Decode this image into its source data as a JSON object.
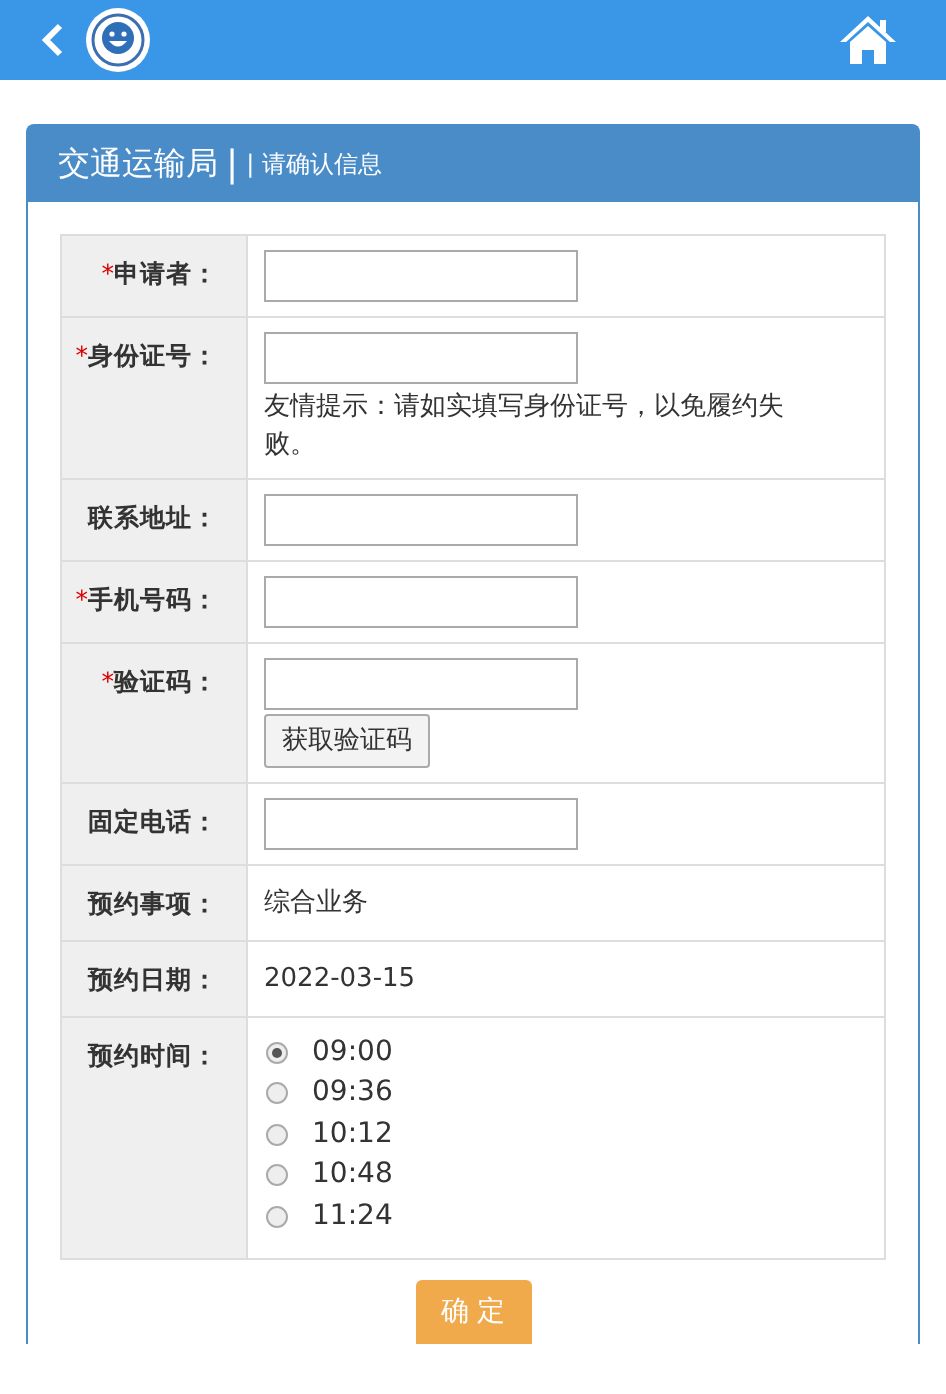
{
  "panel": {
    "title": "交通运输局",
    "separator": "|",
    "subtitle": "| 请确认信息"
  },
  "rows": [
    {
      "kind": "input",
      "required_mark": "*",
      "label": "申请者："
    },
    {
      "kind": "input_hint",
      "required_mark": "*",
      "label": "身份证号：",
      "hint": "友情提示：请如实填写身份证号，以免履约失败。"
    },
    {
      "kind": "input",
      "label": "联系地址："
    },
    {
      "kind": "input",
      "required_mark": "*",
      "label": "手机号码："
    },
    {
      "kind": "input_button",
      "required_mark": "*",
      "label": "验证码：",
      "button": "获取验证码"
    },
    {
      "kind": "input",
      "label": "固定电话："
    },
    {
      "kind": "text",
      "label": "预约事项：",
      "value": "综合业务"
    },
    {
      "kind": "text",
      "label": "预约日期：",
      "value": "2022-03-15"
    },
    {
      "kind": "radio",
      "label": "预约时间：",
      "options": [
        {
          "label": "09:00",
          "selected": true
        },
        {
          "label": "09:36",
          "selected": false
        },
        {
          "label": "10:12",
          "selected": false
        },
        {
          "label": "10:48",
          "selected": false
        },
        {
          "label": "11:24",
          "selected": false
        }
      ]
    }
  ],
  "submit": "确 定"
}
